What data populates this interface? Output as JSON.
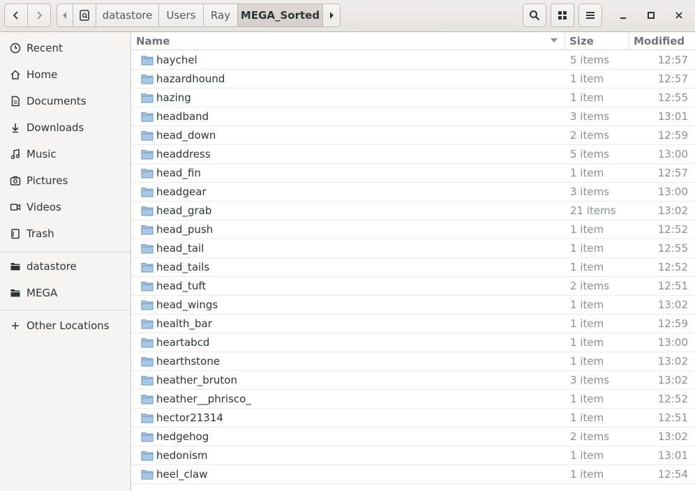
{
  "header": {
    "breadcrumbs": [
      "datastore",
      "Users",
      "Ray",
      "MEGA_Sorted"
    ],
    "active_crumb": "MEGA_Sorted"
  },
  "sidebar": {
    "items": [
      {
        "label": "Recent",
        "icon": "clock-icon"
      },
      {
        "label": "Home",
        "icon": "home-icon"
      },
      {
        "label": "Documents",
        "icon": "document-icon"
      },
      {
        "label": "Downloads",
        "icon": "download-icon"
      },
      {
        "label": "Music",
        "icon": "music-icon"
      },
      {
        "label": "Pictures",
        "icon": "camera-icon"
      },
      {
        "label": "Videos",
        "icon": "video-icon"
      },
      {
        "label": "Trash",
        "icon": "trash-icon"
      }
    ],
    "drives": [
      {
        "label": "datastore",
        "icon": "folder-icon"
      },
      {
        "label": "MEGA",
        "icon": "folder-icon"
      }
    ],
    "other": {
      "label": "Other Locations",
      "icon": "plus-icon"
    }
  },
  "columns": {
    "name": "Name",
    "size": "Size",
    "modified": "Modified"
  },
  "files": [
    {
      "name": "haychel",
      "size": "5 items",
      "modified": "12:57"
    },
    {
      "name": "hazardhound",
      "size": "1 item",
      "modified": "12:57"
    },
    {
      "name": "hazing",
      "size": "1 item",
      "modified": "12:55"
    },
    {
      "name": "headband",
      "size": "3 items",
      "modified": "13:01"
    },
    {
      "name": "head_down",
      "size": "2 items",
      "modified": "12:59"
    },
    {
      "name": "headdress",
      "size": "5 items",
      "modified": "13:00"
    },
    {
      "name": "head_fin",
      "size": "1 item",
      "modified": "12:57"
    },
    {
      "name": "headgear",
      "size": "3 items",
      "modified": "13:00"
    },
    {
      "name": "head_grab",
      "size": "21 items",
      "modified": "13:02"
    },
    {
      "name": "head_push",
      "size": "1 item",
      "modified": "12:52"
    },
    {
      "name": "head_tail",
      "size": "1 item",
      "modified": "12:55"
    },
    {
      "name": "head_tails",
      "size": "1 item",
      "modified": "12:52"
    },
    {
      "name": "head_tuft",
      "size": "2 items",
      "modified": "12:51"
    },
    {
      "name": "head_wings",
      "size": "1 item",
      "modified": "13:02"
    },
    {
      "name": "health_bar",
      "size": "1 item",
      "modified": "12:59"
    },
    {
      "name": "heartabcd",
      "size": "1 item",
      "modified": "13:00"
    },
    {
      "name": "hearthstone",
      "size": "1 item",
      "modified": "13:02"
    },
    {
      "name": "heather_bruton",
      "size": "3 items",
      "modified": "13:02"
    },
    {
      "name": "heather__phrisco_",
      "size": "1 item",
      "modified": "12:52"
    },
    {
      "name": "hector21314",
      "size": "1 item",
      "modified": "12:51"
    },
    {
      "name": "hedgehog",
      "size": "2 items",
      "modified": "13:02"
    },
    {
      "name": "hedonism",
      "size": "1 item",
      "modified": "13:01"
    },
    {
      "name": "heel_claw",
      "size": "1 item",
      "modified": "12:54"
    }
  ]
}
